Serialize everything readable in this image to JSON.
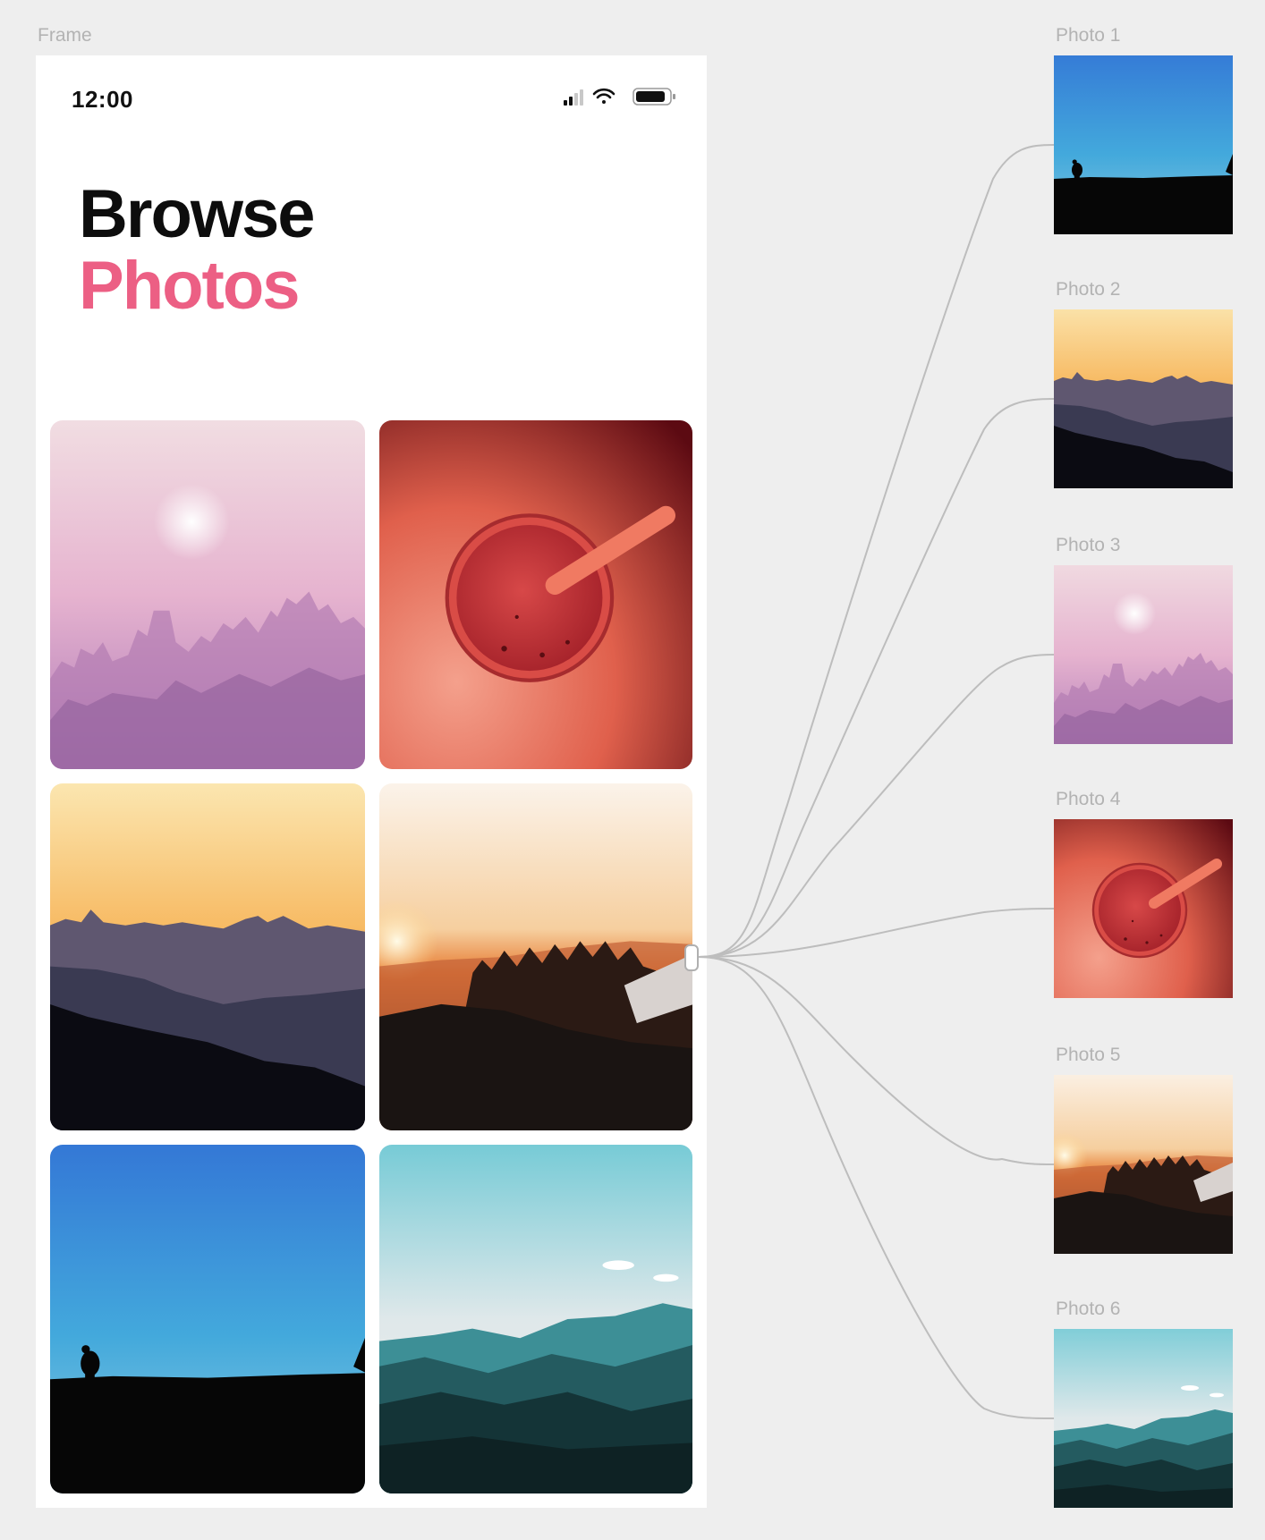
{
  "canvas": {
    "frame_label": "Frame",
    "background": "#eeeeee"
  },
  "status_bar": {
    "time": "12:00",
    "icons": [
      "signal-icon",
      "wifi-icon",
      "battery-icon"
    ]
  },
  "header": {
    "line1": "Browse",
    "line2": "Photos",
    "accent_color": "#ec5f84"
  },
  "grid": {
    "tiles": [
      {
        "name": "hazy-city-pink"
      },
      {
        "name": "red-drink-topdown"
      },
      {
        "name": "sunset-mountains"
      },
      {
        "name": "forest-sunrise"
      },
      {
        "name": "hiker-blue-sky"
      },
      {
        "name": "teal-hills"
      }
    ]
  },
  "components": [
    {
      "label": "Photo 1",
      "image": "hiker-blue-sky"
    },
    {
      "label": "Photo 2",
      "image": "sunset-mountains"
    },
    {
      "label": "Photo 3",
      "image": "hazy-city-pink"
    },
    {
      "label": "Photo 4",
      "image": "red-drink-topdown"
    },
    {
      "label": "Photo 5",
      "image": "forest-sunrise"
    },
    {
      "label": "Photo 6",
      "image": "teal-hills"
    }
  ]
}
